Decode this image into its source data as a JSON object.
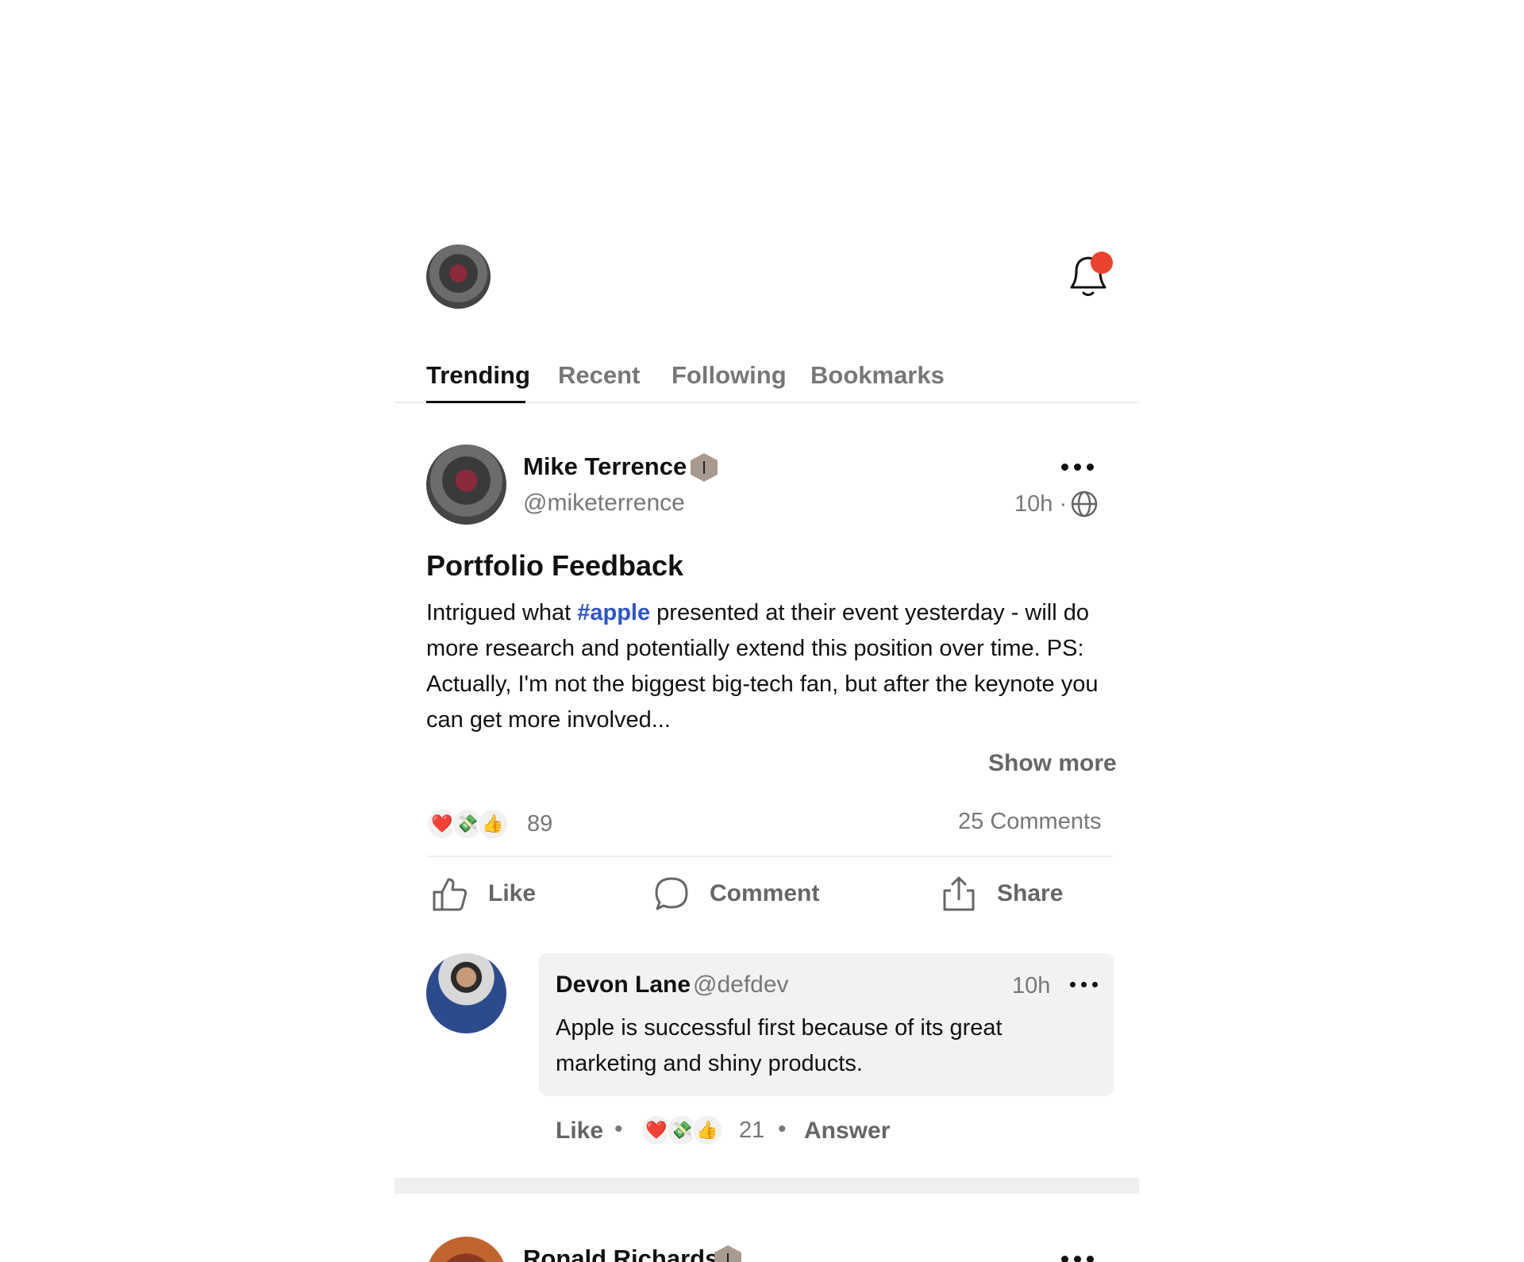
{
  "tabs": [
    "Trending",
    "Recent",
    "Following",
    "Bookmarks"
  ],
  "post": {
    "author_name": "Mike Terrence",
    "author_handle": "@miketerrence",
    "time": "10h",
    "title": "Portfolio Feedback",
    "body_before": "Intrigued what ",
    "hashtag": "#apple",
    "body_after": " presented at their event yesterday - will do more research and potentially extend this position over time. PS: Actually, I'm not the biggest big-tech fan, but after the keynote you can get more involved...",
    "show_more": "Show more",
    "reactions_count": "89",
    "comments_count": "25 Comments",
    "actions": {
      "like": "Like",
      "comment": "Comment",
      "share": "Share"
    }
  },
  "comment": {
    "author_name": "Devon Lane",
    "author_handle": "@defdev",
    "time": "10h",
    "text": "Apple is successful first because of its great marketing and shiny products.",
    "like": "Like",
    "reactions_count": "21",
    "answer": "Answer"
  },
  "next_post": {
    "author_name": "Ronald Richards"
  },
  "reaction_emojis": [
    "❤️",
    "💸",
    "👍"
  ],
  "notification_dot_color": "#e8442f",
  "hashtag_color": "#2d55c8",
  "icons": [
    "user-avatar",
    "bell-icon",
    "verified-badge-icon",
    "more-icon",
    "globe-icon",
    "thumbs-up-icon",
    "comment-icon",
    "share-icon"
  ]
}
